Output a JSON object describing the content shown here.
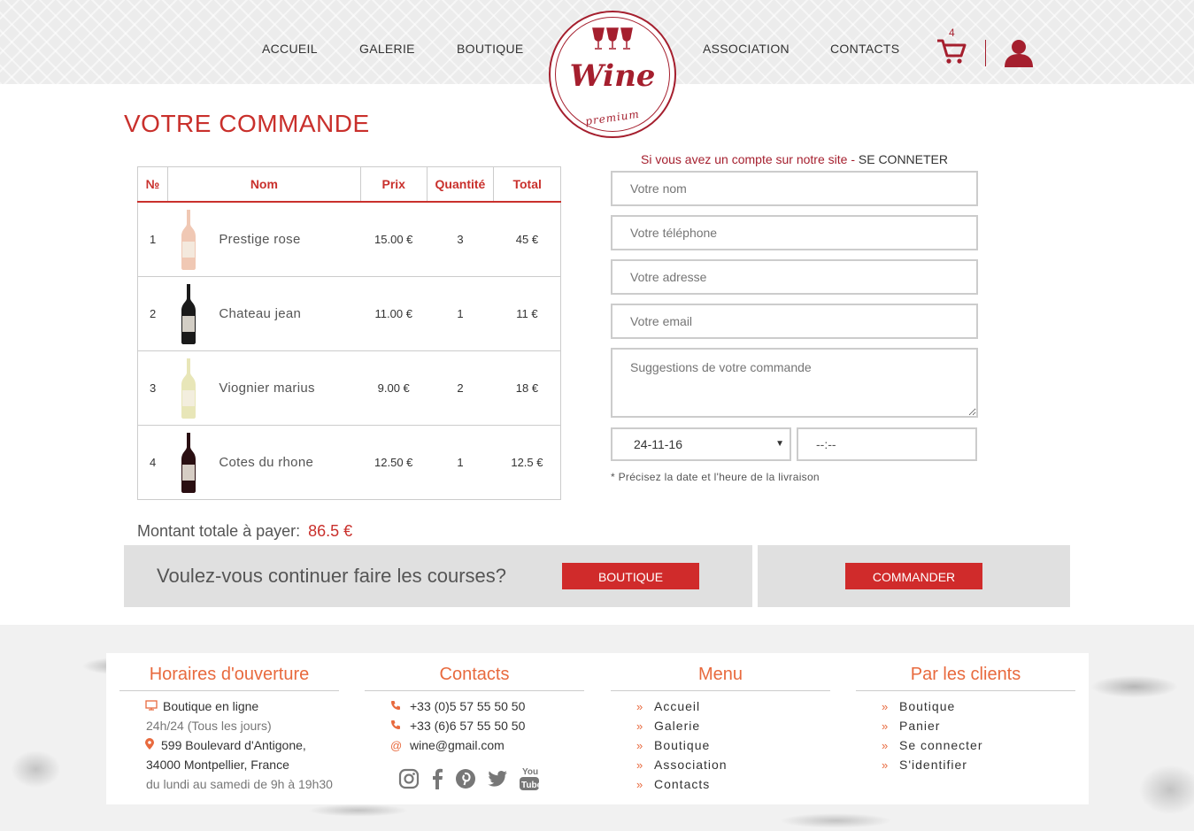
{
  "nav": {
    "accueil": "ACCUEIL",
    "galerie": "GALERIE",
    "boutique": "BOUTIQUE",
    "association": "ASSOCIATION",
    "contacts": "CONTACTS",
    "cart_count": "4"
  },
  "logo": {
    "word": "Wine",
    "sub": "premium"
  },
  "page_title": "VOTRE COMMANDE",
  "table": {
    "headers": {
      "num": "№",
      "nom": "Nom",
      "prix": "Prix",
      "quantite": "Quantité",
      "total": "Total"
    },
    "rows": [
      {
        "num": "1",
        "name": "Prestige rose",
        "price": "15.00 €",
        "qty": "3",
        "total": "45 €",
        "bottle_color": "#f0c8b4"
      },
      {
        "num": "2",
        "name": "Chateau jean",
        "price": "11.00 €",
        "qty": "1",
        "total": "11 €",
        "bottle_color": "#1a1a1a"
      },
      {
        "num": "3",
        "name": "Viognier marius",
        "price": "9.00 €",
        "qty": "2",
        "total": "18 €",
        "bottle_color": "#e8e6b8"
      },
      {
        "num": "4",
        "name": "Cotes du rhone",
        "price": "12.50 €",
        "qty": "1",
        "total": "12.5 €",
        "bottle_color": "#2a0f12"
      }
    ]
  },
  "total": {
    "label": "Montant totale à payer:",
    "amount": "86.5 €"
  },
  "form": {
    "login_note": "Si vous avez un compte sur notre site - ",
    "login_link": "SE CONNETER",
    "name_placeholder": "Votre nom",
    "phone_placeholder": "Votre téléphone",
    "address_placeholder": "Votre adresse",
    "email_placeholder": "Votre email",
    "suggestions_placeholder": "Suggestions de votre commande",
    "date_value": "24-11-16",
    "time_value": "--:--",
    "date_note": "* Précisez la date et l'heure de la livraison"
  },
  "actions": {
    "question": "Voulez-vous continuer faire les courses?",
    "boutique_button": "BOUTIQUE",
    "commander_button": "COMMANDER"
  },
  "footer": {
    "hours": {
      "title": "Horaires d'ouverture",
      "online": "Boutique en ligne",
      "always": "24h/24 (Tous les jours)",
      "address1": "599 Boulevard d'Antigone,",
      "address2": "34000 Montpellier, France",
      "schedule": "du lundi au samedi de 9h à 19h30"
    },
    "contacts": {
      "title": "Contacts",
      "phone1": "+33 (0)5 57 55 50 50",
      "phone2": "+33 (6)6 57 55 50 50",
      "email": "wine@gmail.com"
    },
    "menu": {
      "title": "Menu",
      "items": [
        "Accueil",
        "Galerie",
        "Boutique",
        "Association",
        "Contacts"
      ]
    },
    "clients": {
      "title": "Par les clients",
      "items": [
        "Boutique",
        "Panier",
        "Se connecter",
        "S'identifier"
      ]
    },
    "social": [
      "instagram-icon",
      "facebook-icon",
      "pinterest-icon",
      "twitter-icon",
      "youtube-icon"
    ]
  },
  "colors": {
    "accent": "#c9302c",
    "brand": "#a51f2e",
    "footer_accent": "#e86a3e"
  }
}
